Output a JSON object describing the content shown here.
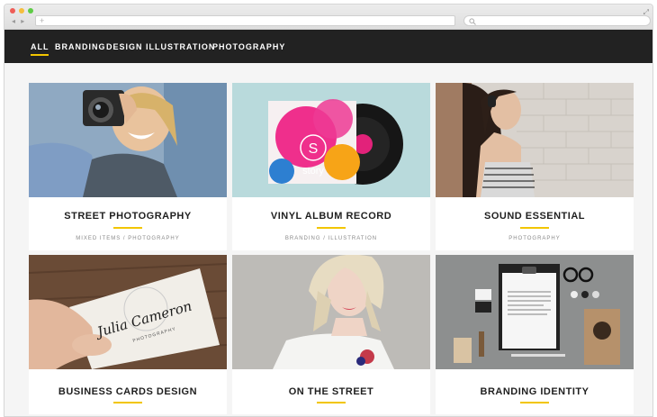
{
  "browser": {
    "address_placeholder": "+"
  },
  "nav": {
    "items": [
      "ALL",
      "BRANDING",
      "DESIGN",
      "ILLUSTRATION",
      "PHOTOGRAPHY"
    ],
    "active": "ALL"
  },
  "portfolio": {
    "items": [
      {
        "title": "STREET PHOTOGRAPHY",
        "tags": "MIXED ITEMS / PHOTOGRAPHY",
        "image": "woman-with-camera"
      },
      {
        "title": "VINYL ALBUM RECORD",
        "tags": "BRANDING / ILLUSTRATION",
        "image": "vinyl-record-sleeve",
        "artwork_text": "S",
        "artwork_word": "story"
      },
      {
        "title": "SOUND ESSENTIAL",
        "tags": "PHOTOGRAPHY",
        "image": "woman-with-headphones"
      },
      {
        "title": "BUSINESS CARDS DESIGN",
        "tags": "",
        "image": "business-card-in-hand",
        "card_name": "Julia Cameron",
        "card_sub": "PHOTOGRAPHY"
      },
      {
        "title": "ON THE STREET",
        "tags": "",
        "image": "blonde-woman-portrait"
      },
      {
        "title": "BRANDING IDENTITY",
        "tags": "",
        "image": "stationery-mockup"
      }
    ]
  },
  "colors": {
    "accent": "#f2c500",
    "nav_bg": "#222222",
    "page_bg": "#f5f5f5"
  }
}
